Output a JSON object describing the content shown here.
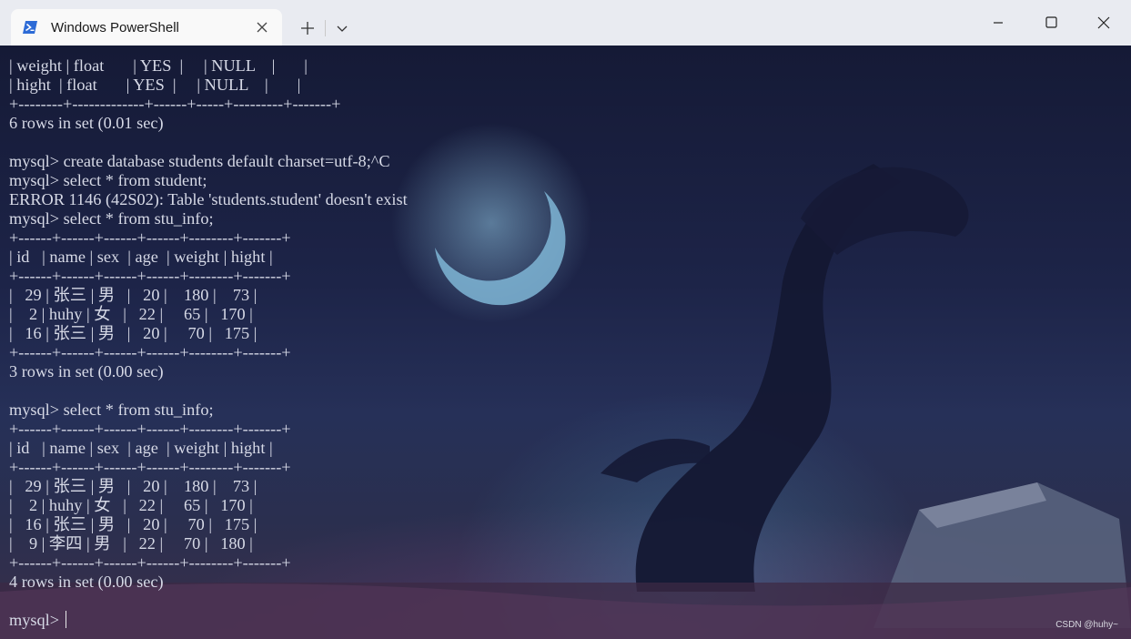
{
  "window": {
    "tab_title": "Windows PowerShell",
    "tab_icon": "powershell-icon",
    "buttons": [
      "new-tab-icon",
      "dropdown-chevron-icon",
      "minimize-icon",
      "maximize-icon",
      "close-icon"
    ]
  },
  "terminal": {
    "lines": [
      "| weight | float       | YES  |     | NULL    |       |",
      "| hight  | float       | YES  |     | NULL    |       |",
      "+--------+-------------+------+-----+---------+-------+",
      "6 rows in set (0.01 sec)",
      "",
      "mysql> create database students default charset=utf-8;^C",
      "mysql> select * from student;",
      "ERROR 1146 (42S02): Table 'students.student' doesn't exist",
      "mysql> select * from stu_info;",
      "+------+------+------+------+--------+-------+",
      "| id   | name | sex  | age  | weight | hight |",
      "+------+------+------+------+--------+-------+",
      "|   29 | 张三 | 男   |   20 |    180 |    73 |",
      "|    2 | huhy | 女   |   22 |     65 |   170 |",
      "|   16 | 张三 | 男   |   20 |     70 |   175 |",
      "+------+------+------+------+--------+-------+",
      "3 rows in set (0.00 sec)",
      "",
      "mysql> select * from stu_info;",
      "+------+------+------+------+--------+-------+",
      "| id   | name | sex  | age  | weight | hight |",
      "+------+------+------+------+--------+-------+",
      "|   29 | 张三 | 男   |   20 |    180 |    73 |",
      "|    2 | huhy | 女   |   22 |     65 |   170 |",
      "|   16 | 张三 | 男   |   20 |     70 |   175 |",
      "|    9 | 李四 | 男   |   22 |     70 |   180 |",
      "+------+------+------+------+--------+-------+",
      "4 rows in set (0.00 sec)",
      "",
      "mysql> "
    ]
  },
  "watermark": "CSDN @huhy~",
  "colors": {
    "titlebar": "#e9ebf1",
    "tab": "#f9f9f9",
    "terminal_text": "#d6d9e6",
    "powershell_blue": "#2d6bd6"
  }
}
